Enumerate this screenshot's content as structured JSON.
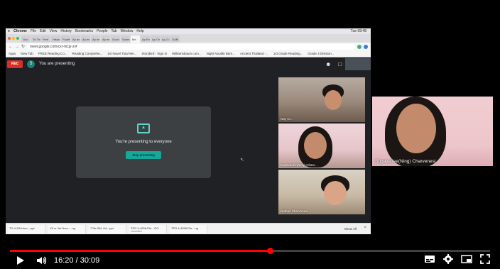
{
  "mac_menu": {
    "items": [
      "Chrome",
      "File",
      "Edit",
      "View",
      "History",
      "Bookmarks",
      "People",
      "Tab",
      "Window",
      "Help"
    ],
    "status": "Tue 09:48"
  },
  "tabs": [
    "Goo",
    "Tri Tin",
    "Fred",
    "Histor",
    "Fourth",
    "Ap en",
    "Ap en",
    "Ap en",
    "Ap en",
    "Good",
    "Subm",
    "Me",
    "Ap En",
    "Ap Ch",
    "Ap 2 C",
    "GAM"
  ],
  "address": {
    "url": "meet.google.com/cxr-mcjy-zvf"
  },
  "bookmarks": [
    "Apps",
    "New Tab",
    "FREE Reading Co...",
    "Reading Comprehe...",
    "1st Novel Total We...",
    "Storybird - Sign in",
    "Williamsbaum.com...",
    "Night Noodle Bam...",
    "Ancient Thailand -...",
    "1st Grade Reading...",
    "Grade 3 Division..."
  ],
  "meet": {
    "rec_label": "REC",
    "presenter_initial": "S",
    "presenting_label": "You are presenting",
    "present_message": "You're presenting to everyone",
    "stop_button": "Stop presenting",
    "tile_names": [
      "Nay Gr...",
      "Supavadee(Ning) Charv...",
      "Nathan Charvenesi"
    ]
  },
  "pinned": {
    "name": "Supavadee(Ning) Charvenesi"
  },
  "downloads": {
    "items": [
      {
        "name": "TG 4-2/8-Hum....ppt",
        "sub": ""
      },
      {
        "name": "V5 m Vet Hum.....ng",
        "sub": ""
      },
      {
        "name": "7 Re-SM- HA...ppt",
        "sub": ""
      },
      {
        "name": "TPG 9-4258-Pla....DO",
        "sub": "Cancelled"
      },
      {
        "name": "TPG 4-4258-Pla....ng",
        "sub": ""
      }
    ],
    "show_all": "Show All"
  },
  "player": {
    "time_current": "16:20",
    "time_sep": "/",
    "time_total": "30:09",
    "progress_fraction": 0.541
  },
  "colors": {
    "progress": "#ff0000",
    "rec": "#d93025",
    "accent": "#14a89b"
  }
}
